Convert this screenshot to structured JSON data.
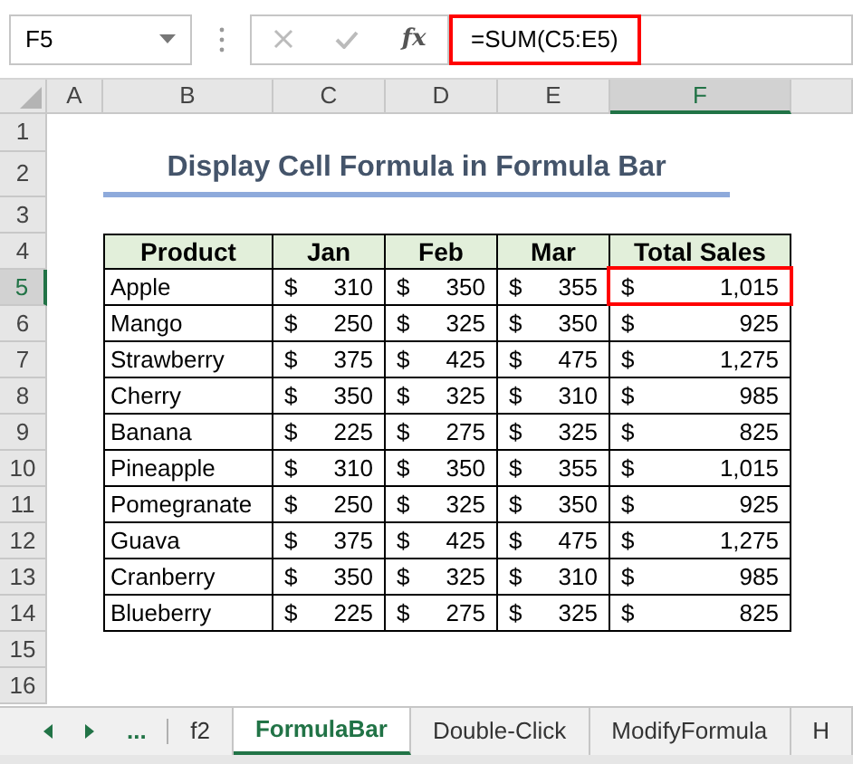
{
  "formula_bar": {
    "name_box": "F5",
    "function_label": "fx",
    "formula": "=SUM(C5:E5)"
  },
  "column_headers": [
    {
      "label": "A",
      "selected": false
    },
    {
      "label": "B",
      "selected": false
    },
    {
      "label": "C",
      "selected": false
    },
    {
      "label": "D",
      "selected": false
    },
    {
      "label": "E",
      "selected": false
    },
    {
      "label": "F",
      "selected": true
    }
  ],
  "row_headers": [
    {
      "label": "1",
      "selected": false
    },
    {
      "label": "2",
      "selected": false
    },
    {
      "label": "3",
      "selected": false
    },
    {
      "label": "4",
      "selected": false
    },
    {
      "label": "5",
      "selected": true
    },
    {
      "label": "6",
      "selected": false
    },
    {
      "label": "7",
      "selected": false
    },
    {
      "label": "8",
      "selected": false
    },
    {
      "label": "9",
      "selected": false
    },
    {
      "label": "10",
      "selected": false
    },
    {
      "label": "11",
      "selected": false
    },
    {
      "label": "12",
      "selected": false
    },
    {
      "label": "13",
      "selected": false
    },
    {
      "label": "14",
      "selected": false
    },
    {
      "label": "15",
      "selected": false
    },
    {
      "label": "16",
      "selected": false
    }
  ],
  "title": "Display Cell Formula in Formula Bar",
  "table": {
    "columns": [
      "Product",
      "Jan",
      "Feb",
      "Mar",
      "Total Sales"
    ],
    "rows": [
      {
        "product": "Apple",
        "values": [
          [
            "$",
            "310"
          ],
          [
            "$",
            "350"
          ],
          [
            "$",
            "355"
          ],
          [
            "$",
            "1,015"
          ]
        ],
        "selected": true
      },
      {
        "product": "Mango",
        "values": [
          [
            "$",
            "250"
          ],
          [
            "$",
            "325"
          ],
          [
            "$",
            "350"
          ],
          [
            "$",
            "925"
          ]
        ],
        "selected": false
      },
      {
        "product": "Strawberry",
        "values": [
          [
            "$",
            "375"
          ],
          [
            "$",
            "425"
          ],
          [
            "$",
            "475"
          ],
          [
            "$",
            "1,275"
          ]
        ],
        "selected": false
      },
      {
        "product": "Cherry",
        "values": [
          [
            "$",
            "350"
          ],
          [
            "$",
            "325"
          ],
          [
            "$",
            "310"
          ],
          [
            "$",
            "985"
          ]
        ],
        "selected": false
      },
      {
        "product": "Banana",
        "values": [
          [
            "$",
            "225"
          ],
          [
            "$",
            "275"
          ],
          [
            "$",
            "325"
          ],
          [
            "$",
            "825"
          ]
        ],
        "selected": false
      },
      {
        "product": "Pineapple",
        "values": [
          [
            "$",
            "310"
          ],
          [
            "$",
            "350"
          ],
          [
            "$",
            "355"
          ],
          [
            "$",
            "1,015"
          ]
        ],
        "selected": false
      },
      {
        "product": "Pomegranate",
        "values": [
          [
            "$",
            "250"
          ],
          [
            "$",
            "325"
          ],
          [
            "$",
            "350"
          ],
          [
            "$",
            "925"
          ]
        ],
        "selected": false
      },
      {
        "product": "Guava",
        "values": [
          [
            "$",
            "375"
          ],
          [
            "$",
            "425"
          ],
          [
            "$",
            "475"
          ],
          [
            "$",
            "1,275"
          ]
        ],
        "selected": false
      },
      {
        "product": "Cranberry",
        "values": [
          [
            "$",
            "350"
          ],
          [
            "$",
            "325"
          ],
          [
            "$",
            "310"
          ],
          [
            "$",
            "985"
          ]
        ],
        "selected": false
      },
      {
        "product": "Blueberry",
        "values": [
          [
            "$",
            "225"
          ],
          [
            "$",
            "275"
          ],
          [
            "$",
            "325"
          ],
          [
            "$",
            "825"
          ]
        ],
        "selected": false
      }
    ]
  },
  "sheet_tabs": {
    "more": "...",
    "tabs": [
      {
        "label": "f2",
        "selected": false
      },
      {
        "label": "FormulaBar",
        "selected": true
      },
      {
        "label": "Double-Click",
        "selected": false
      },
      {
        "label": "ModifyFormula",
        "selected": false
      },
      {
        "label": "H",
        "selected": false
      }
    ]
  }
}
